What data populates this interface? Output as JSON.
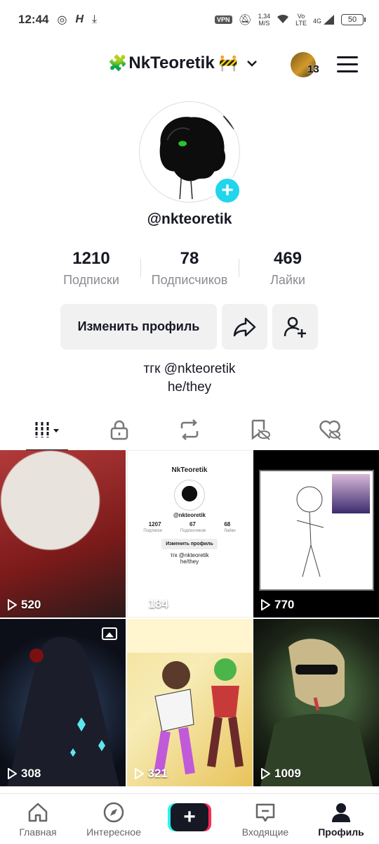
{
  "status_bar": {
    "time": "12:44",
    "vpn": "VPN",
    "speed_value": "1,34",
    "speed_unit": "M/S",
    "volte_top": "Vo",
    "volte_bottom": "LTE",
    "network": "4G",
    "battery": "50"
  },
  "header": {
    "username": "NkTeoretik",
    "left_emoji": "🧩",
    "right_emoji": "🚧",
    "avatar_badge": "13"
  },
  "profile": {
    "handle": "@nkteoretik",
    "stats": [
      {
        "value": "1210",
        "label": "Подписки"
      },
      {
        "value": "78",
        "label": "Подписчиков"
      },
      {
        "value": "469",
        "label": "Лайки"
      }
    ],
    "edit_button": "Изменить профиль",
    "bio_line1": "тгк @nkteoretik",
    "bio_line2": "he/they"
  },
  "tabs": [
    {
      "icon": "grid-icon",
      "active": true
    },
    {
      "icon": "lock-icon"
    },
    {
      "icon": "repost-icon"
    },
    {
      "icon": "bookmark-icon"
    },
    {
      "icon": "liked-icon"
    }
  ],
  "videos": [
    {
      "views": "520"
    },
    {
      "views": "184"
    },
    {
      "views": "770"
    },
    {
      "views": "308"
    },
    {
      "views": "321"
    },
    {
      "views": "1009"
    }
  ],
  "mini_screenshot": {
    "title": "NkTeoretik",
    "handle": "@nkteoretik",
    "stats": [
      "1207",
      "67",
      "68"
    ],
    "labels": [
      "Подписки",
      "Подписчиков",
      "Лайки"
    ],
    "edit": "Изменить профиль",
    "bio1": "тгк @nkteoretik",
    "bio2": "he/they"
  },
  "nav": {
    "home": "Главная",
    "explore": "Интересное",
    "inbox": "Входящие",
    "profile": "Профиль"
  }
}
